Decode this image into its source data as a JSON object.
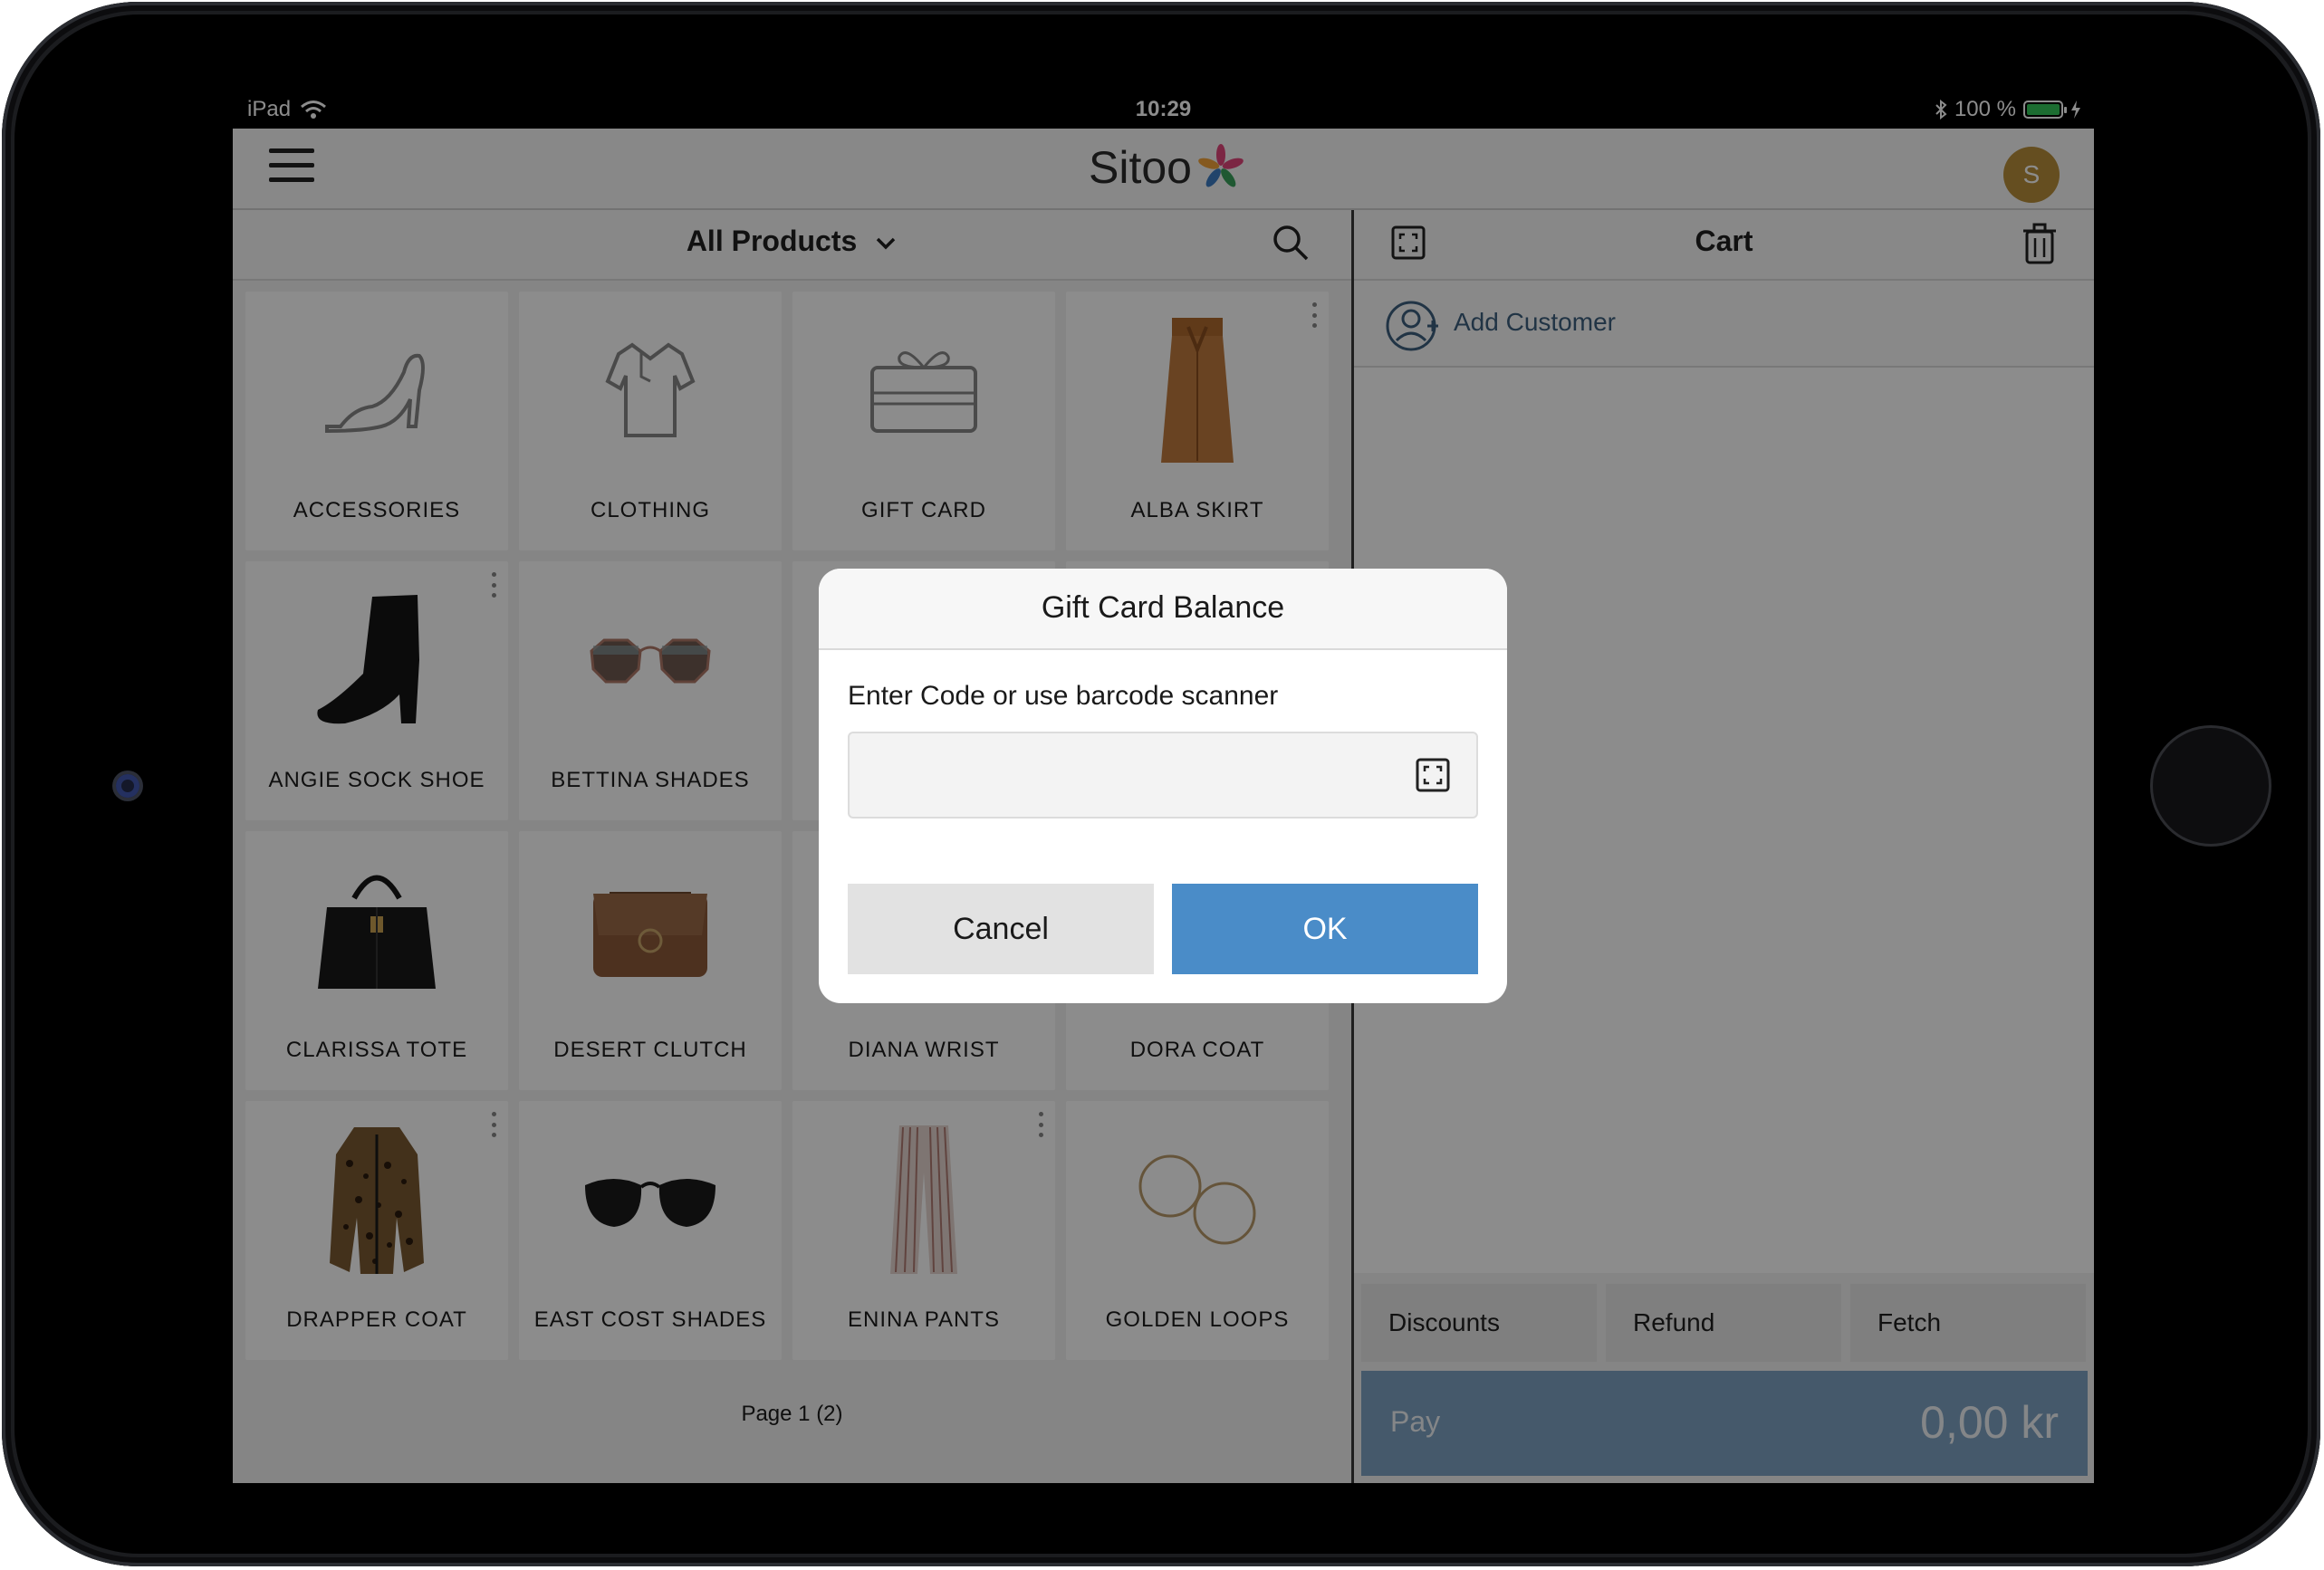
{
  "status_bar": {
    "device": "iPad",
    "time": "10:29",
    "battery": "100 %",
    "battery_level": 1.0
  },
  "header": {
    "logo_text": "Sitoo",
    "avatar_initial": "S"
  },
  "products": {
    "category_selector": "All Products",
    "tiles": [
      {
        "label": "ACCESSORIES",
        "icon": "high-heel-shoe-icon",
        "options": false
      },
      {
        "label": "CLOTHING",
        "icon": "polo-shirt-icon",
        "options": false
      },
      {
        "label": "GIFT CARD",
        "icon": "gift-card-icon",
        "options": false
      },
      {
        "label": "ALBA SKIRT",
        "icon": "skirt-image",
        "options": true
      },
      {
        "label": "ANGIE SOCK SHOE",
        "icon": "boot-image",
        "options": true
      },
      {
        "label": "BETTINA SHADES",
        "icon": "sunglasses-image",
        "options": false
      },
      {
        "label": "",
        "icon": "",
        "options": false
      },
      {
        "label": "",
        "icon": "",
        "options": false
      },
      {
        "label": "CLARISSA TOTE",
        "icon": "tote-bag-image",
        "options": false
      },
      {
        "label": "DESERT CLUTCH",
        "icon": "clutch-bag-image",
        "options": false
      },
      {
        "label": "DIANA WRIST",
        "icon": "bracelet-image",
        "options": false
      },
      {
        "label": "DORA COAT",
        "icon": "coat-image",
        "options": false
      },
      {
        "label": "DRAPPER COAT",
        "icon": "leopard-coat-image",
        "options": true
      },
      {
        "label": "EAST COST SHADES",
        "icon": "round-sunglasses-image",
        "options": false
      },
      {
        "label": "ENINA PANTS",
        "icon": "striped-pants-image",
        "options": true
      },
      {
        "label": "GOLDEN LOOPS",
        "icon": "hoop-earrings-image",
        "options": false
      }
    ],
    "pagination": "Page 1 (2)"
  },
  "cart": {
    "title": "Cart",
    "add_customer": "Add Customer",
    "actions": [
      "Discounts",
      "Refund",
      "Fetch"
    ],
    "pay_label": "Pay",
    "pay_amount": "0,00 kr"
  },
  "dialog": {
    "title": "Gift Card Balance",
    "prompt": "Enter Code or use barcode scanner",
    "input_value": "",
    "cancel_label": "Cancel",
    "ok_label": "OK"
  },
  "colors": {
    "accent": "#4a8cc8",
    "pay_button": "#7ea3c3",
    "customer_link": "#3d5f7e",
    "avatar": "#b88f3b"
  }
}
